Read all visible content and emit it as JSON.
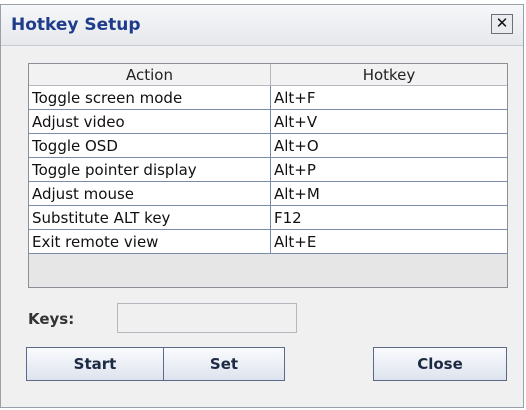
{
  "window": {
    "title": "Hotkey Setup",
    "close_glyph": "✕"
  },
  "table": {
    "columns": [
      "Action",
      "Hotkey"
    ],
    "rows": [
      {
        "action": "Toggle screen mode",
        "hotkey": "Alt+F"
      },
      {
        "action": "Adjust video",
        "hotkey": "Alt+V"
      },
      {
        "action": "Toggle OSD",
        "hotkey": "Alt+O"
      },
      {
        "action": "Toggle pointer display",
        "hotkey": "Alt+P"
      },
      {
        "action": "Adjust mouse",
        "hotkey": "Alt+M"
      },
      {
        "action": "Substitute ALT key",
        "hotkey": "F12"
      },
      {
        "action": "Exit remote view",
        "hotkey": "Alt+E"
      }
    ]
  },
  "keys": {
    "label": "Keys:",
    "value": ""
  },
  "buttons": {
    "start": "Start",
    "set": "Set",
    "close": "Close"
  },
  "colors": {
    "title_text": "#1f3c8c",
    "grid_line": "#7a8aa8"
  }
}
